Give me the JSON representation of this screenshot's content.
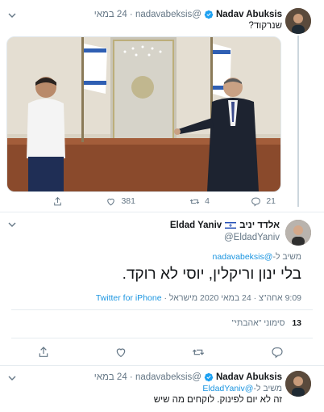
{
  "tweet1": {
    "name": "Nadav Abuksis",
    "handle": "@nadavabeksis",
    "date": "24 במאי",
    "text": "שנרקוד?",
    "actions": {
      "reply_count": "21",
      "retweet_count": "4",
      "like_count": "381"
    }
  },
  "tweet2": {
    "name": "אלדד יניב",
    "name_en": "Eldad Yaniv",
    "handle": "@EldadYaniv",
    "reply_prefix": "משיב ל-",
    "reply_to": "@nadavabeksis",
    "text": "בלי ינון וריקלין, יוסי לא רוקד.",
    "time": "9:09 אחה\"צ",
    "date": "24 במאי 2020",
    "location": "מישראל",
    "client": "Twitter for iPhone",
    "likes_count": "13",
    "likes_label": "סימוני \"אהבתי\""
  },
  "tweet3": {
    "name": "Nadav Abuksis",
    "handle": "@nadavabeksis",
    "date": "24 במאי",
    "reply_prefix": "משיב ל-",
    "reply_to": "@EldadYaniv",
    "text": "זה לא יום לפינוק. לוקחים מה שיש"
  },
  "colors": {
    "link": "#1b95e0",
    "secondary_text": "#657786",
    "divider": "#e6ecf0",
    "verified": "#1da1f2"
  },
  "icons": [
    "chevron-down-icon",
    "verified-badge-icon",
    "reply-icon",
    "retweet-icon",
    "like-icon",
    "share-icon",
    "israel-flag-icon"
  ]
}
